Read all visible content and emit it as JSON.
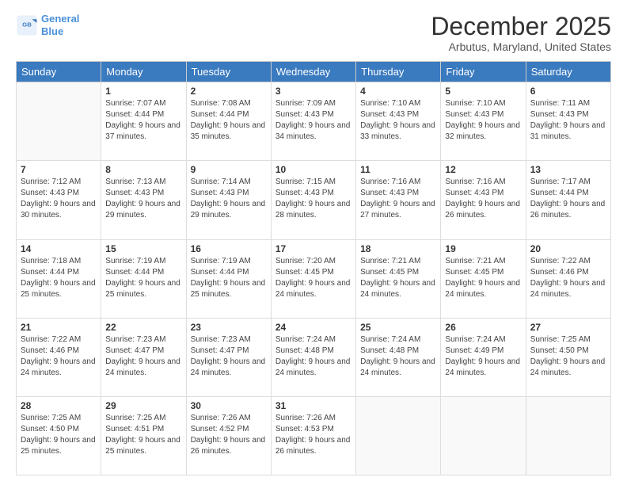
{
  "logo": {
    "line1": "General",
    "line2": "Blue"
  },
  "title": "December 2025",
  "subtitle": "Arbutus, Maryland, United States",
  "days_of_week": [
    "Sunday",
    "Monday",
    "Tuesday",
    "Wednesday",
    "Thursday",
    "Friday",
    "Saturday"
  ],
  "weeks": [
    [
      {
        "day": "",
        "sunrise": "",
        "sunset": "",
        "daylight": ""
      },
      {
        "day": "1",
        "sunrise": "Sunrise: 7:07 AM",
        "sunset": "Sunset: 4:44 PM",
        "daylight": "Daylight: 9 hours and 37 minutes."
      },
      {
        "day": "2",
        "sunrise": "Sunrise: 7:08 AM",
        "sunset": "Sunset: 4:44 PM",
        "daylight": "Daylight: 9 hours and 35 minutes."
      },
      {
        "day": "3",
        "sunrise": "Sunrise: 7:09 AM",
        "sunset": "Sunset: 4:43 PM",
        "daylight": "Daylight: 9 hours and 34 minutes."
      },
      {
        "day": "4",
        "sunrise": "Sunrise: 7:10 AM",
        "sunset": "Sunset: 4:43 PM",
        "daylight": "Daylight: 9 hours and 33 minutes."
      },
      {
        "day": "5",
        "sunrise": "Sunrise: 7:10 AM",
        "sunset": "Sunset: 4:43 PM",
        "daylight": "Daylight: 9 hours and 32 minutes."
      },
      {
        "day": "6",
        "sunrise": "Sunrise: 7:11 AM",
        "sunset": "Sunset: 4:43 PM",
        "daylight": "Daylight: 9 hours and 31 minutes."
      }
    ],
    [
      {
        "day": "7",
        "sunrise": "Sunrise: 7:12 AM",
        "sunset": "Sunset: 4:43 PM",
        "daylight": "Daylight: 9 hours and 30 minutes."
      },
      {
        "day": "8",
        "sunrise": "Sunrise: 7:13 AM",
        "sunset": "Sunset: 4:43 PM",
        "daylight": "Daylight: 9 hours and 29 minutes."
      },
      {
        "day": "9",
        "sunrise": "Sunrise: 7:14 AM",
        "sunset": "Sunset: 4:43 PM",
        "daylight": "Daylight: 9 hours and 29 minutes."
      },
      {
        "day": "10",
        "sunrise": "Sunrise: 7:15 AM",
        "sunset": "Sunset: 4:43 PM",
        "daylight": "Daylight: 9 hours and 28 minutes."
      },
      {
        "day": "11",
        "sunrise": "Sunrise: 7:16 AM",
        "sunset": "Sunset: 4:43 PM",
        "daylight": "Daylight: 9 hours and 27 minutes."
      },
      {
        "day": "12",
        "sunrise": "Sunrise: 7:16 AM",
        "sunset": "Sunset: 4:43 PM",
        "daylight": "Daylight: 9 hours and 26 minutes."
      },
      {
        "day": "13",
        "sunrise": "Sunrise: 7:17 AM",
        "sunset": "Sunset: 4:44 PM",
        "daylight": "Daylight: 9 hours and 26 minutes."
      }
    ],
    [
      {
        "day": "14",
        "sunrise": "Sunrise: 7:18 AM",
        "sunset": "Sunset: 4:44 PM",
        "daylight": "Daylight: 9 hours and 25 minutes."
      },
      {
        "day": "15",
        "sunrise": "Sunrise: 7:19 AM",
        "sunset": "Sunset: 4:44 PM",
        "daylight": "Daylight: 9 hours and 25 minutes."
      },
      {
        "day": "16",
        "sunrise": "Sunrise: 7:19 AM",
        "sunset": "Sunset: 4:44 PM",
        "daylight": "Daylight: 9 hours and 25 minutes."
      },
      {
        "day": "17",
        "sunrise": "Sunrise: 7:20 AM",
        "sunset": "Sunset: 4:45 PM",
        "daylight": "Daylight: 9 hours and 24 minutes."
      },
      {
        "day": "18",
        "sunrise": "Sunrise: 7:21 AM",
        "sunset": "Sunset: 4:45 PM",
        "daylight": "Daylight: 9 hours and 24 minutes."
      },
      {
        "day": "19",
        "sunrise": "Sunrise: 7:21 AM",
        "sunset": "Sunset: 4:45 PM",
        "daylight": "Daylight: 9 hours and 24 minutes."
      },
      {
        "day": "20",
        "sunrise": "Sunrise: 7:22 AM",
        "sunset": "Sunset: 4:46 PM",
        "daylight": "Daylight: 9 hours and 24 minutes."
      }
    ],
    [
      {
        "day": "21",
        "sunrise": "Sunrise: 7:22 AM",
        "sunset": "Sunset: 4:46 PM",
        "daylight": "Daylight: 9 hours and 24 minutes."
      },
      {
        "day": "22",
        "sunrise": "Sunrise: 7:23 AM",
        "sunset": "Sunset: 4:47 PM",
        "daylight": "Daylight: 9 hours and 24 minutes."
      },
      {
        "day": "23",
        "sunrise": "Sunrise: 7:23 AM",
        "sunset": "Sunset: 4:47 PM",
        "daylight": "Daylight: 9 hours and 24 minutes."
      },
      {
        "day": "24",
        "sunrise": "Sunrise: 7:24 AM",
        "sunset": "Sunset: 4:48 PM",
        "daylight": "Daylight: 9 hours and 24 minutes."
      },
      {
        "day": "25",
        "sunrise": "Sunrise: 7:24 AM",
        "sunset": "Sunset: 4:48 PM",
        "daylight": "Daylight: 9 hours and 24 minutes."
      },
      {
        "day": "26",
        "sunrise": "Sunrise: 7:24 AM",
        "sunset": "Sunset: 4:49 PM",
        "daylight": "Daylight: 9 hours and 24 minutes."
      },
      {
        "day": "27",
        "sunrise": "Sunrise: 7:25 AM",
        "sunset": "Sunset: 4:50 PM",
        "daylight": "Daylight: 9 hours and 24 minutes."
      }
    ],
    [
      {
        "day": "28",
        "sunrise": "Sunrise: 7:25 AM",
        "sunset": "Sunset: 4:50 PM",
        "daylight": "Daylight: 9 hours and 25 minutes."
      },
      {
        "day": "29",
        "sunrise": "Sunrise: 7:25 AM",
        "sunset": "Sunset: 4:51 PM",
        "daylight": "Daylight: 9 hours and 25 minutes."
      },
      {
        "day": "30",
        "sunrise": "Sunrise: 7:26 AM",
        "sunset": "Sunset: 4:52 PM",
        "daylight": "Daylight: 9 hours and 26 minutes."
      },
      {
        "day": "31",
        "sunrise": "Sunrise: 7:26 AM",
        "sunset": "Sunset: 4:53 PM",
        "daylight": "Daylight: 9 hours and 26 minutes."
      },
      {
        "day": "",
        "sunrise": "",
        "sunset": "",
        "daylight": ""
      },
      {
        "day": "",
        "sunrise": "",
        "sunset": "",
        "daylight": ""
      },
      {
        "day": "",
        "sunrise": "",
        "sunset": "",
        "daylight": ""
      }
    ]
  ]
}
